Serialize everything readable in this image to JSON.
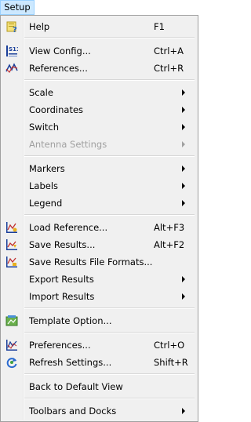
{
  "menubar": {
    "setup_label": "Setup"
  },
  "menu": {
    "help": {
      "label": "Help",
      "shortcut": "F1"
    },
    "view_config": {
      "label": "View Config...",
      "shortcut": "Ctrl+A"
    },
    "references": {
      "label": "References...",
      "shortcut": "Ctrl+R"
    },
    "scale": {
      "label": "Scale"
    },
    "coordinates": {
      "label": "Coordinates"
    },
    "switch": {
      "label": "Switch"
    },
    "antenna_settings": {
      "label": "Antenna Settings"
    },
    "markers": {
      "label": "Markers"
    },
    "labels": {
      "label": "Labels"
    },
    "legend": {
      "label": "Legend"
    },
    "load_reference": {
      "label": "Load Reference...",
      "shortcut": "Alt+F3"
    },
    "save_results": {
      "label": "Save Results...",
      "shortcut": "Alt+F2"
    },
    "save_results_formats": {
      "label": "Save Results File Formats..."
    },
    "export_results": {
      "label": "Export Results"
    },
    "import_results": {
      "label": "Import Results"
    },
    "template_option": {
      "label": "Template Option..."
    },
    "preferences": {
      "label": "Preferences...",
      "shortcut": "Ctrl+O"
    },
    "refresh_settings": {
      "label": "Refresh Settings...",
      "shortcut": "Shift+R"
    },
    "back_to_default": {
      "label": "Back to Default View"
    },
    "toolbars_docks": {
      "label": "Toolbars and Docks"
    }
  },
  "icons": {
    "help": "help-icon",
    "view_config": "s11-config-icon",
    "references": "references-icon",
    "load_reference": "chart-load-icon",
    "save_results": "chart-save-icon",
    "save_results_formats": "chart-formats-icon",
    "template_option": "template-icon",
    "preferences": "preferences-icon",
    "refresh_settings": "refresh-icon"
  },
  "colors": {
    "menu_bg": "#f0f0f0",
    "menubar_highlight": "#cce8ff",
    "disabled_text": "#a0a0a0",
    "separator": "#d7d7d7"
  }
}
